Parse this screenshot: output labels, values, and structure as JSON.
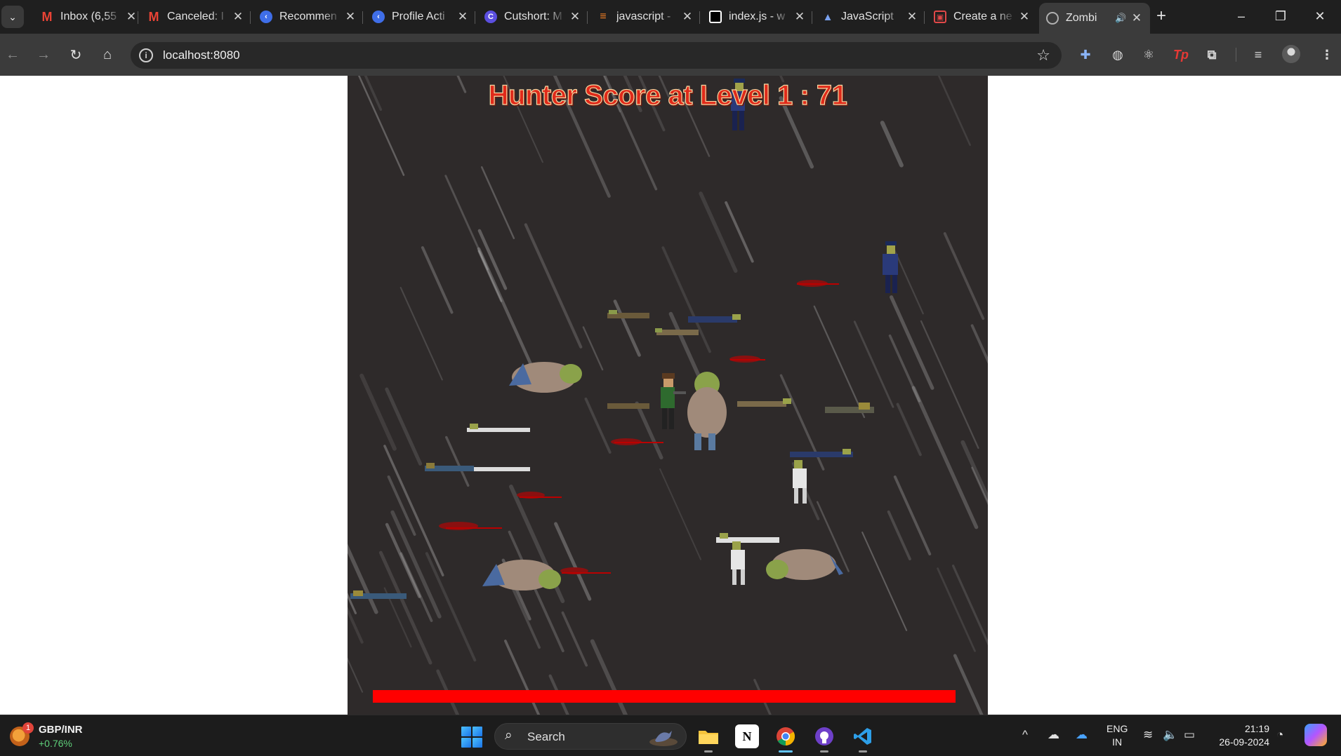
{
  "browser": {
    "tab_search_icon": "chevron-down-icon",
    "tabs": [
      {
        "title": "Inbox (6,55",
        "favicon": "gmail-icon",
        "favicon_color": "#ea4335"
      },
      {
        "title": "Canceled: I",
        "favicon": "gmail-icon",
        "favicon_color": "#ea4335"
      },
      {
        "title": "Recommen",
        "favicon": "kotlin-icon",
        "favicon_color": "#3f6ee8"
      },
      {
        "title": "Profile Acti",
        "favicon": "kotlin-icon",
        "favicon_color": "#3f6ee8"
      },
      {
        "title": "Cutshort: M",
        "favicon": "cutshort-icon",
        "favicon_color": "#5b4fe0"
      },
      {
        "title": "javascript -",
        "favicon": "stackoverflow-icon",
        "favicon_color": "#f48024"
      },
      {
        "title": "index.js - w",
        "favicon": "codesandbox-icon",
        "favicon_color": "#000000"
      },
      {
        "title": "JavaScript",
        "favicon": "triangle-logo-icon",
        "favicon_color": "#4a74c9"
      },
      {
        "title": "Create a ne",
        "favicon": "store-icon",
        "favicon_color": "#e04848"
      },
      {
        "title": "Zombi",
        "favicon": "globe-icon",
        "favicon_color": "#9a9a9a",
        "active": true,
        "audio": true
      }
    ],
    "new_tab_label": "+",
    "window_controls": {
      "minimize": "–",
      "restore": "❐",
      "close": "✕"
    },
    "url": "localhost:8080",
    "extensions": [
      "puzzle-ext-icon",
      "ghost-ext-icon",
      "react-ext-icon",
      "tp-ext-icon",
      "extensions-icon",
      "media-control-icon",
      "profile-avatar",
      "kebab-menu-icon"
    ],
    "tp_label": "Tp"
  },
  "game": {
    "score_text": "Hunter Score at Level 1 : 71",
    "level": 1,
    "score": 71,
    "health_percent": 100,
    "health_color": "#ff0000",
    "background_color": "#2e2a2a"
  },
  "taskbar": {
    "widget": {
      "pair": "GBP/INR",
      "change": "+0.76%",
      "badge": "1"
    },
    "search_placeholder": "Search",
    "apps": [
      "file-explorer-icon",
      "notion-icon",
      "chrome-icon",
      "github-desktop-icon",
      "vscode-icon"
    ],
    "language": {
      "line1": "ENG",
      "line2": "IN"
    },
    "time": "21:19",
    "date": "26-09-2024"
  }
}
